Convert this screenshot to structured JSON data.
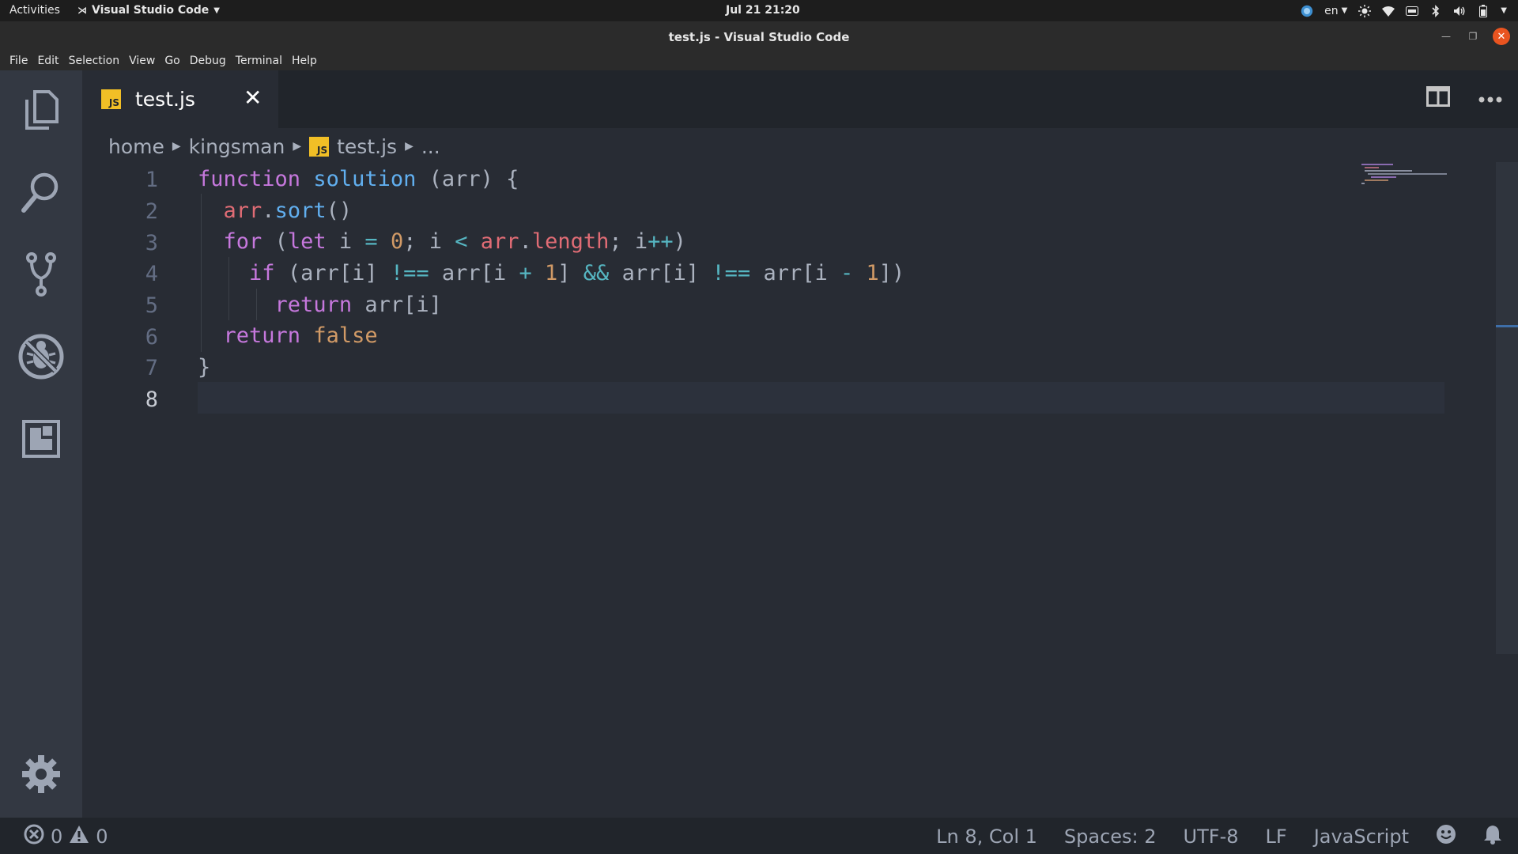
{
  "topbar": {
    "activities": "Activities",
    "app_name": "Visual Studio Code",
    "clock": "Jul 21  21:20",
    "lang": "en"
  },
  "window": {
    "title": "test.js - Visual Studio Code"
  },
  "menu": [
    "File",
    "Edit",
    "Selection",
    "View",
    "Go",
    "Debug",
    "Terminal",
    "Help"
  ],
  "activity_icons": [
    "files-icon",
    "search-icon",
    "source-control-icon",
    "debug-icon",
    "extensions-icon",
    "gear-icon"
  ],
  "tab": {
    "badge": "JS",
    "label": "test.js",
    "close": "✕"
  },
  "breadcrumb": {
    "parts": [
      "home",
      "kingsman",
      "test.js",
      "..."
    ],
    "badge": "JS"
  },
  "editor": {
    "line_numbers": [
      "1",
      "2",
      "3",
      "4",
      "5",
      "6",
      "7",
      "8"
    ],
    "active_line": 8
  },
  "status": {
    "errors": "0",
    "warnings": "0",
    "position": "Ln 8, Col 1",
    "spaces": "Spaces: 2",
    "encoding": "UTF-8",
    "eol": "LF",
    "language": "JavaScript"
  },
  "colors": {
    "keyword": "#c678dd",
    "function": "#61afef",
    "variable": "#e06c75",
    "number": "#d19a66",
    "operator": "#56b6c2",
    "js_badge": "#f1bf26",
    "close_button": "#e95420"
  }
}
